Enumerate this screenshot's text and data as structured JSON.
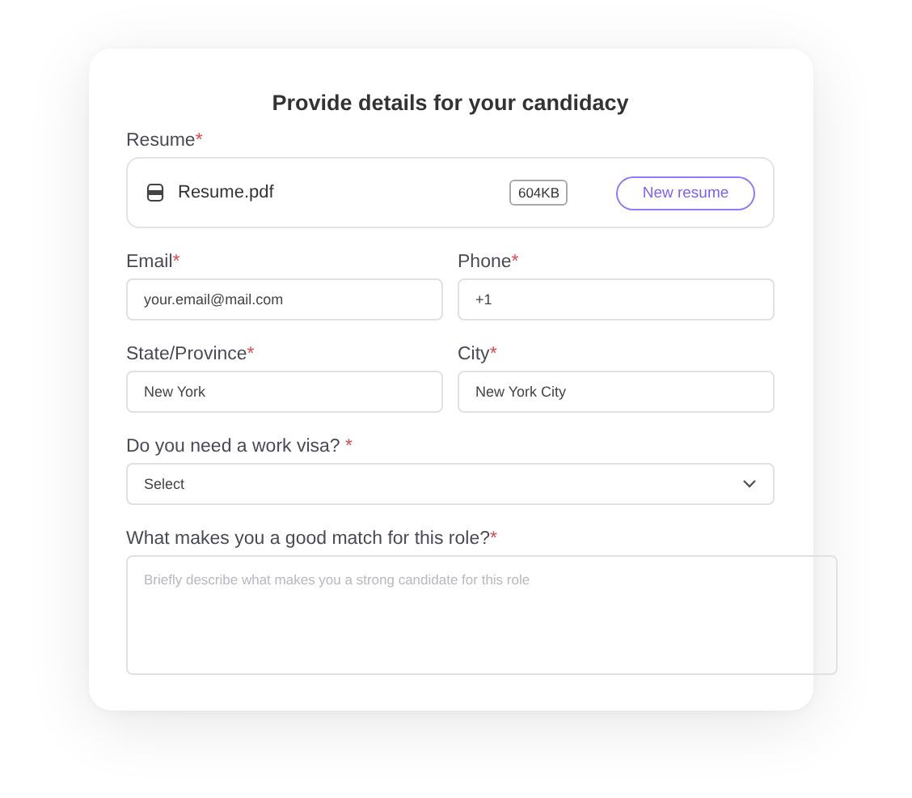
{
  "title": "Provide details for your candidacy",
  "resume": {
    "label": "Resume",
    "required_mark": "*",
    "file_name": "Resume.pdf",
    "file_size": "604KB",
    "button": "New resume"
  },
  "fields": [
    {
      "kind": "input",
      "label": "Email",
      "required_mark": "*",
      "value": "your.email@mail.com"
    },
    {
      "kind": "input",
      "label": "Phone",
      "required_mark": "*",
      "value": "+1"
    },
    {
      "kind": "input",
      "label": "State/Province",
      "required_mark": "*",
      "value": "New York"
    },
    {
      "kind": "input",
      "label": "City",
      "required_mark": "*",
      "value": "New York City"
    },
    {
      "kind": "select",
      "label": "Do you need a work visa?",
      "required_mark": " *",
      "value": "Select"
    },
    {
      "kind": "textarea",
      "label": "What makes you a good match for this role?",
      "required_mark": "*",
      "placeholder": "Briefly describe what makes you a strong candidate for this role"
    }
  ]
}
